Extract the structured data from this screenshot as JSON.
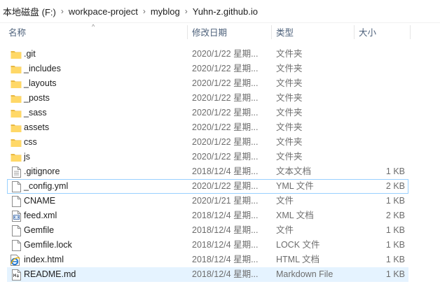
{
  "address": {
    "crumbs": [
      "本地磁盘 (F:)",
      "workpace-project",
      "myblog",
      "Yuhn-z.github.io"
    ],
    "separator": "›"
  },
  "columns": {
    "name": "名称",
    "date": "修改日期",
    "type": "类型",
    "size": "大小",
    "sort_indicator": "^"
  },
  "files": [
    {
      "name": ".git",
      "date": "2020/1/22 星期...",
      "type": "文件夹",
      "size": "",
      "icon": "folder-icon"
    },
    {
      "name": "_includes",
      "date": "2020/1/22 星期...",
      "type": "文件夹",
      "size": "",
      "icon": "folder-icon"
    },
    {
      "name": "_layouts",
      "date": "2020/1/22 星期...",
      "type": "文件夹",
      "size": "",
      "icon": "folder-icon"
    },
    {
      "name": "_posts",
      "date": "2020/1/22 星期...",
      "type": "文件夹",
      "size": "",
      "icon": "folder-icon"
    },
    {
      "name": "_sass",
      "date": "2020/1/22 星期...",
      "type": "文件夹",
      "size": "",
      "icon": "folder-icon"
    },
    {
      "name": "assets",
      "date": "2020/1/22 星期...",
      "type": "文件夹",
      "size": "",
      "icon": "folder-icon"
    },
    {
      "name": "css",
      "date": "2020/1/22 星期...",
      "type": "文件夹",
      "size": "",
      "icon": "folder-icon"
    },
    {
      "name": "js",
      "date": "2020/1/22 星期...",
      "type": "文件夹",
      "size": "",
      "icon": "folder-icon"
    },
    {
      "name": ".gitignore",
      "date": "2018/12/4 星期...",
      "type": "文本文档",
      "size": "1 KB",
      "icon": "text-file-icon"
    },
    {
      "name": "_config.yml",
      "date": "2020/1/22 星期...",
      "type": "YML 文件",
      "size": "2 KB",
      "icon": "blank-file-icon",
      "focused": true
    },
    {
      "name": "CNAME",
      "date": "2020/1/21 星期...",
      "type": "文件",
      "size": "1 KB",
      "icon": "blank-file-icon"
    },
    {
      "name": "feed.xml",
      "date": "2018/12/4 星期...",
      "type": "XML 文档",
      "size": "2 KB",
      "icon": "xml-file-icon"
    },
    {
      "name": "Gemfile",
      "date": "2018/12/4 星期...",
      "type": "文件",
      "size": "1 KB",
      "icon": "blank-file-icon"
    },
    {
      "name": "Gemfile.lock",
      "date": "2018/12/4 星期...",
      "type": "LOCK 文件",
      "size": "1 KB",
      "icon": "blank-file-icon"
    },
    {
      "name": "index.html",
      "date": "2018/12/4 星期...",
      "type": "HTML 文档",
      "size": "1 KB",
      "icon": "ie-html-icon"
    },
    {
      "name": "README.md",
      "date": "2018/12/4 星期...",
      "type": "Markdown File",
      "size": "1 KB",
      "icon": "markdown-file-icon",
      "selected": true
    }
  ],
  "colors": {
    "selection": "#e5f3ff",
    "focus_border": "#99d1ff",
    "folder": "#ffd867",
    "header_text": "#4c607a"
  }
}
